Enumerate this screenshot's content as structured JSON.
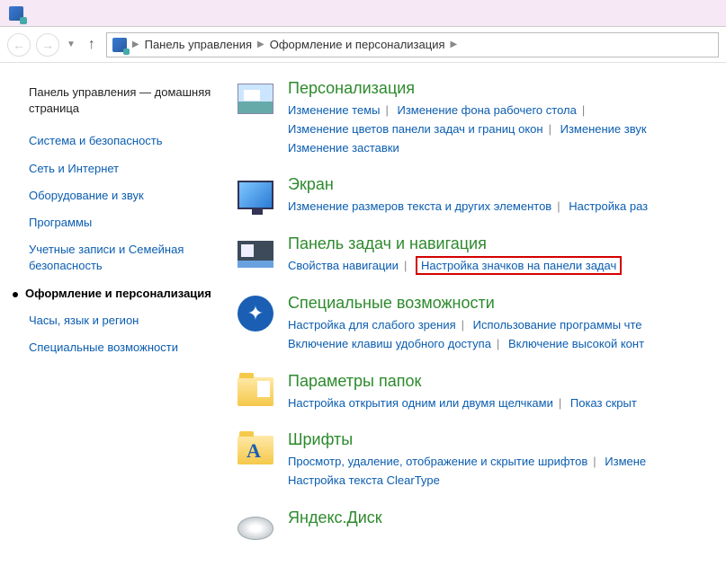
{
  "breadcrumb": {
    "seg1": "Панель управления",
    "seg2": "Оформление и персонализация"
  },
  "sidebar": {
    "home": "Панель управления — домашняя страница",
    "items": [
      "Система и безопасность",
      "Сеть и Интернет",
      "Оборудование и звук",
      "Программы",
      "Учетные записи и Семейная безопасность"
    ],
    "current": "Оформление и персонализация",
    "after": [
      "Часы, язык и регион",
      "Специальные возможности"
    ]
  },
  "categories": [
    {
      "title": "Персонализация",
      "links": [
        "Изменение темы",
        "Изменение фона рабочего стола",
        "Изменение цветов панели задач и границ окон",
        "Изменение звук",
        "Изменение заставки"
      ]
    },
    {
      "title": "Экран",
      "links": [
        "Изменение размеров текста и других элементов",
        "Настройка раз"
      ]
    },
    {
      "title": "Панель задач и навигация",
      "links": [
        "Свойства навигации",
        "Настройка значков на панели задач"
      ],
      "highlight_index": 1
    },
    {
      "title": "Специальные возможности",
      "links": [
        "Настройка для слабого зрения",
        "Использование программы чте",
        "Включение клавиш удобного доступа",
        "Включение высокой конт"
      ]
    },
    {
      "title": "Параметры папок",
      "links": [
        "Настройка открытия одним или двумя щелчками",
        "Показ скрыт"
      ]
    },
    {
      "title": "Шрифты",
      "links": [
        "Просмотр, удаление, отображение и скрытие шрифтов",
        "Измене",
        "Настройка текста ClearType"
      ]
    },
    {
      "title": "Яндекс.Диск",
      "links": []
    }
  ]
}
